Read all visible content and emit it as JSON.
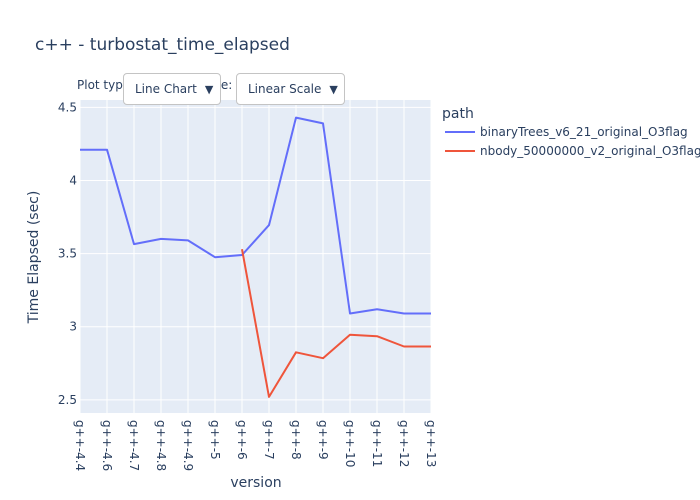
{
  "controls": {
    "plot_type_label": "Plot type:",
    "plot_type_value": "Line Chart",
    "scale_label": "Scale:",
    "scale_value": "Linear Scale"
  },
  "colors": {
    "plot_bg": "#e5ecf6",
    "grid": "#ffffff",
    "text": "#2a3f5f"
  },
  "chart_data": {
    "type": "line",
    "title": "c++ - turbostat_time_elapsed",
    "xlabel": "version",
    "ylabel": "Time Elapsed (sec)",
    "categories": [
      "g++-4.4",
      "g++-4.6",
      "g++-4.7",
      "g++-4.8",
      "g++-4.9",
      "g++-5",
      "g++-6",
      "g++-7",
      "g++-8",
      "g++-9",
      "g++-10",
      "g++-11",
      "g++-12",
      "g++-13"
    ],
    "ylim": [
      2.41,
      4.55
    ],
    "yticks": [
      2.5,
      3,
      3.5,
      4,
      4.5
    ],
    "ytick_labels": [
      "2.5",
      "3",
      "3.5",
      "4",
      "4.5"
    ],
    "grid": true,
    "legend_title": "path",
    "legend_position": "right",
    "series": [
      {
        "name": "binaryTrees_v6_21_original_O3flag",
        "color": "#636efa",
        "values": [
          4.21,
          4.21,
          3.565,
          3.6,
          3.59,
          3.475,
          3.49,
          3.695,
          4.43,
          4.39,
          3.09,
          3.12,
          3.09,
          3.09
        ]
      },
      {
        "name": "nbody_50000000_v2_original_O3flag",
        "color": "#ef553b",
        "values": [
          null,
          null,
          null,
          null,
          null,
          null,
          3.53,
          2.52,
          2.825,
          2.785,
          2.945,
          2.935,
          2.865,
          2.865
        ]
      }
    ]
  }
}
